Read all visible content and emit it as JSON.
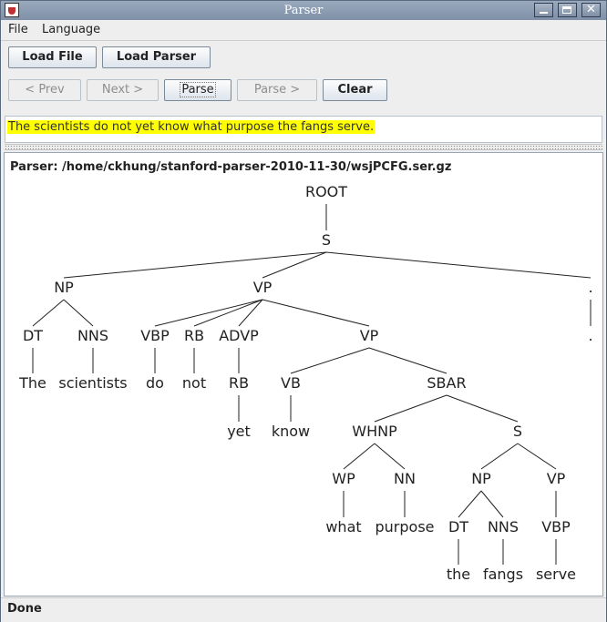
{
  "window": {
    "title": "Parser"
  },
  "menubar": {
    "items": [
      {
        "label": "File"
      },
      {
        "label": "Language"
      }
    ]
  },
  "toolbar": {
    "load_file": "Load File",
    "load_parser": "Load Parser",
    "prev": "< Prev",
    "next": "Next >",
    "parse": "Parse",
    "parse_next": "Parse >",
    "clear": "Clear"
  },
  "sentence": {
    "text": "The scientists do not yet know what purpose the fangs serve."
  },
  "parser_info": {
    "label": "Parser: /home/ckhung/stanford-parser-2010-11-30/wsjPCFG.ser.gz"
  },
  "tree": {
    "nodes": [
      {
        "id": "root",
        "label": "ROOT"
      },
      {
        "id": "s",
        "label": "S",
        "parent": "root"
      },
      {
        "id": "np1",
        "label": "NP",
        "parent": "s"
      },
      {
        "id": "vp1",
        "label": "VP",
        "parent": "s"
      },
      {
        "id": "pnct",
        "label": ".",
        "parent": "s"
      },
      {
        "id": "dt1",
        "label": "DT",
        "parent": "np1"
      },
      {
        "id": "nns1",
        "label": "NNS",
        "parent": "np1"
      },
      {
        "id": "w_the1",
        "label": "The",
        "parent": "dt1"
      },
      {
        "id": "w_scientists",
        "label": "scientists",
        "parent": "nns1"
      },
      {
        "id": "vbp1",
        "label": "VBP",
        "parent": "vp1"
      },
      {
        "id": "rb1",
        "label": "RB",
        "parent": "vp1"
      },
      {
        "id": "advp",
        "label": "ADVP",
        "parent": "vp1"
      },
      {
        "id": "vp2",
        "label": "VP",
        "parent": "vp1"
      },
      {
        "id": "w_do",
        "label": "do",
        "parent": "vbp1"
      },
      {
        "id": "w_not",
        "label": "not",
        "parent": "rb1"
      },
      {
        "id": "rb2",
        "label": "RB",
        "parent": "advp"
      },
      {
        "id": "w_yet",
        "label": "yet",
        "parent": "rb2"
      },
      {
        "id": "vb",
        "label": "VB",
        "parent": "vp2"
      },
      {
        "id": "sbar",
        "label": "SBAR",
        "parent": "vp2"
      },
      {
        "id": "w_know",
        "label": "know",
        "parent": "vb"
      },
      {
        "id": "whnp",
        "label": "WHNP",
        "parent": "sbar"
      },
      {
        "id": "s2",
        "label": "S",
        "parent": "sbar"
      },
      {
        "id": "wp",
        "label": "WP",
        "parent": "whnp"
      },
      {
        "id": "nn",
        "label": "NN",
        "parent": "whnp"
      },
      {
        "id": "w_what",
        "label": "what",
        "parent": "wp"
      },
      {
        "id": "w_purpose",
        "label": "purpose",
        "parent": "nn"
      },
      {
        "id": "np2",
        "label": "NP",
        "parent": "s2"
      },
      {
        "id": "vp3",
        "label": "VP",
        "parent": "s2"
      },
      {
        "id": "dt2",
        "label": "DT",
        "parent": "np2"
      },
      {
        "id": "nns2",
        "label": "NNS",
        "parent": "np2"
      },
      {
        "id": "w_the2",
        "label": "the",
        "parent": "dt2"
      },
      {
        "id": "w_fangs",
        "label": "fangs",
        "parent": "nns2"
      },
      {
        "id": "vbp2",
        "label": "VBP",
        "parent": "vp3"
      },
      {
        "id": "w_serve",
        "label": "serve",
        "parent": "vbp2"
      },
      {
        "id": "w_period",
        "label": ".",
        "parent": "pnct"
      }
    ]
  },
  "status": {
    "text": "Done"
  }
}
